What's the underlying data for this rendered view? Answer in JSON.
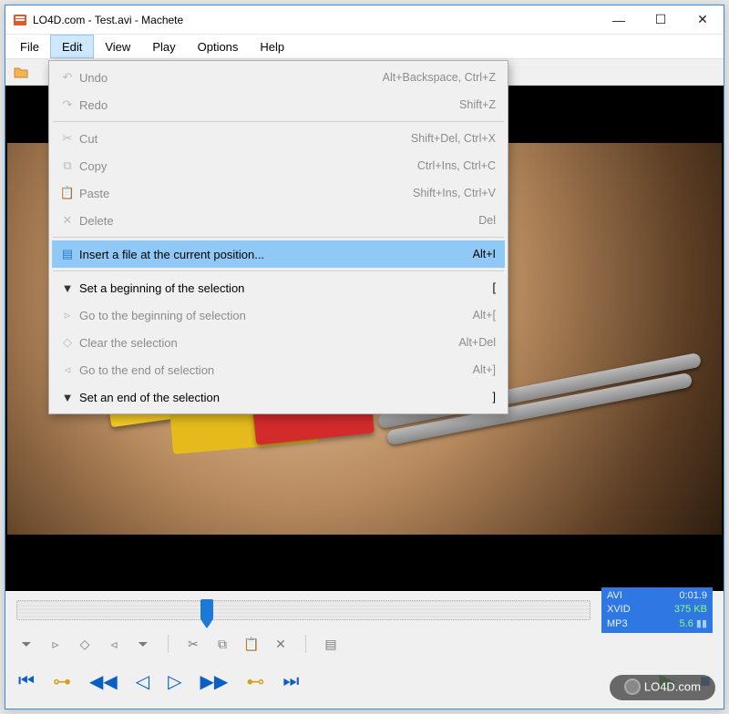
{
  "window": {
    "title": "LO4D.com - Test.avi - Machete",
    "controls": {
      "min": "—",
      "max": "☐",
      "close": "✕"
    }
  },
  "menubar": [
    "File",
    "Edit",
    "View",
    "Play",
    "Options",
    "Help"
  ],
  "menubar_open_index": 1,
  "edit_menu": {
    "undo": {
      "label": "Undo",
      "shortcut": "Alt+Backspace, Ctrl+Z",
      "enabled": false
    },
    "redo": {
      "label": "Redo",
      "shortcut": "Shift+Z",
      "enabled": false
    },
    "cut": {
      "label": "Cut",
      "shortcut": "Shift+Del, Ctrl+X",
      "enabled": false
    },
    "copy": {
      "label": "Copy",
      "shortcut": "Ctrl+Ins, Ctrl+C",
      "enabled": false
    },
    "paste": {
      "label": "Paste",
      "shortcut": "Shift+Ins, Ctrl+V",
      "enabled": false
    },
    "delete": {
      "label": "Delete",
      "shortcut": "Del",
      "enabled": false
    },
    "insert": {
      "label": "Insert a file at the current position...",
      "shortcut": "Alt+I",
      "enabled": true,
      "highlighted": true
    },
    "selbeg": {
      "label": "Set a beginning of the selection",
      "shortcut": "[",
      "enabled": true
    },
    "gobeg": {
      "label": "Go to the beginning of selection",
      "shortcut": "Alt+[",
      "enabled": false
    },
    "clear": {
      "label": "Clear the selection",
      "shortcut": "Alt+Del",
      "enabled": false
    },
    "goend": {
      "label": "Go to the end of selection",
      "shortcut": "Alt+]",
      "enabled": false
    },
    "selend": {
      "label": "Set an end of the selection",
      "shortcut": "]",
      "enabled": true
    }
  },
  "info_panel": {
    "container": "AVI",
    "time": "0:01.9",
    "vcodec": "XVID",
    "size": "375",
    "size_unit": "KB",
    "acodec": "MP3",
    "bitrate": "5.6"
  },
  "seek": {
    "position_pct": 32
  },
  "watermark": "LO4D.com"
}
